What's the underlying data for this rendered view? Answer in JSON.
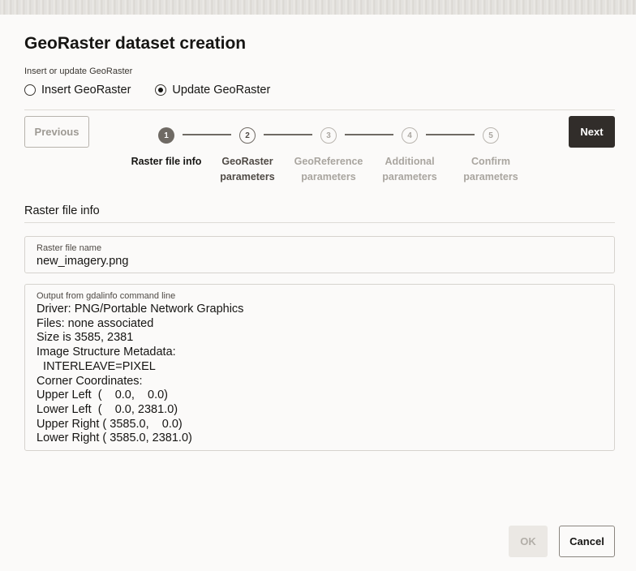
{
  "dialog": {
    "title": "GeoRaster dataset creation",
    "mode_label": "Insert or update GeoRaster",
    "mode_options": [
      {
        "label": "Insert GeoRaster",
        "checked": false
      },
      {
        "label": "Update GeoRaster",
        "checked": true
      }
    ]
  },
  "wizard": {
    "previous_label": "Previous",
    "next_label": "Next",
    "steps": [
      {
        "number": "1",
        "line1": "Raster file info",
        "line2": "",
        "state": "current"
      },
      {
        "number": "2",
        "line1": "GeoRaster",
        "line2": "parameters",
        "state": "visited"
      },
      {
        "number": "3",
        "line1": "GeoReference",
        "line2": "parameters",
        "state": "future"
      },
      {
        "number": "4",
        "line1": "Additional",
        "line2": "parameters",
        "state": "future"
      },
      {
        "number": "5",
        "line1": "Confirm",
        "line2": "parameters",
        "state": "future"
      }
    ]
  },
  "section": {
    "title": "Raster file info",
    "file_name_label": "Raster file name",
    "file_name_value": "new_imagery.png",
    "output_label": "Output from gdalinfo command line",
    "output_text": "Driver: PNG/Portable Network Graphics\nFiles: none associated\nSize is 3585, 2381\nImage Structure Metadata:\n  INTERLEAVE=PIXEL\nCorner Coordinates:\nUpper Left  (    0.0,    0.0)\nLower Left  (    0.0, 2381.0)\nUpper Right ( 3585.0,    0.0)\nLower Right ( 3585.0, 2381.0)"
  },
  "footer": {
    "ok_label": "OK",
    "cancel_label": "Cancel"
  },
  "colors": {
    "primary_button": "#312d2a",
    "train_current": "#6f6a64",
    "disabled_text": "#b2aea8"
  }
}
